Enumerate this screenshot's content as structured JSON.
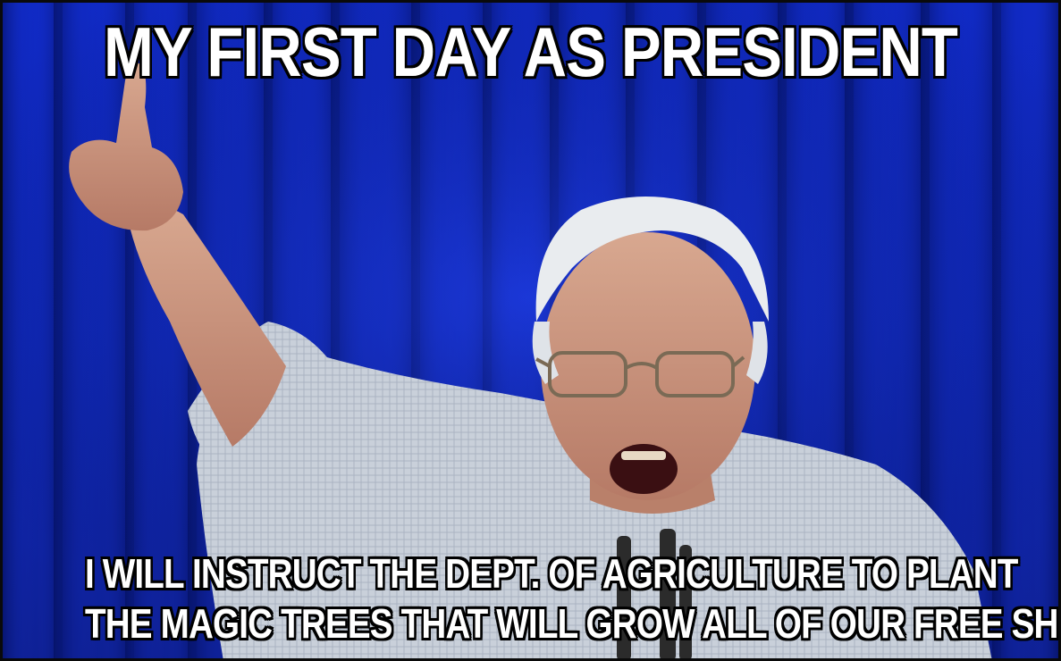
{
  "meme": {
    "top_text": "MY FIRST DAY AS PRESIDENT",
    "bottom_lines": [
      "I WILL INSTRUCT THE DEPT. OF AGRICULTURE TO PLANT",
      "THE MAGIC TREES THAT WILL GROW ALL OF OUR FREE SHIT"
    ]
  },
  "colors": {
    "background": "#0b1e8a",
    "text": "#ffffff",
    "outline": "#000000"
  }
}
